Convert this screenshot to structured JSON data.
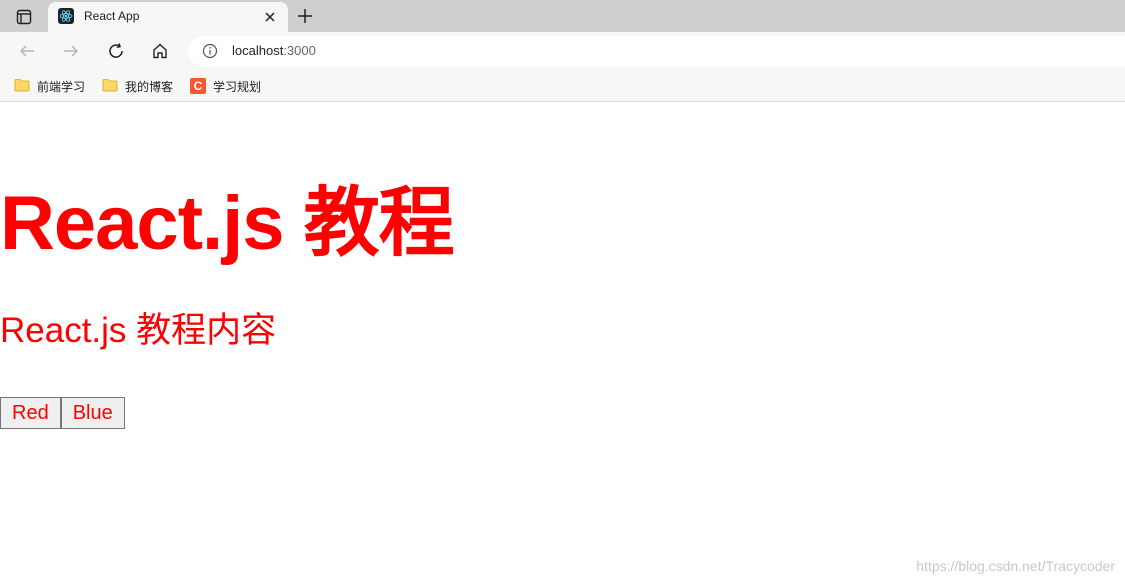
{
  "browser": {
    "tab": {
      "title": "React App",
      "favicon": "react-logo-icon"
    },
    "address": {
      "host": "localhost",
      "port": ":3000"
    },
    "bookmarks": [
      {
        "label": "前端学习",
        "icon": "folder-icon"
      },
      {
        "label": "我的博客",
        "icon": "folder-icon"
      },
      {
        "label": "学习规划",
        "icon": "csdn-icon",
        "icon_letter": "C"
      }
    ]
  },
  "page": {
    "heading": "React.js 教程",
    "subheading": "React.js 教程内容",
    "text_color": "#ff0000",
    "buttons": {
      "red": "Red",
      "blue": "Blue"
    }
  },
  "watermark": "https://blog.csdn.net/Tracycoder"
}
